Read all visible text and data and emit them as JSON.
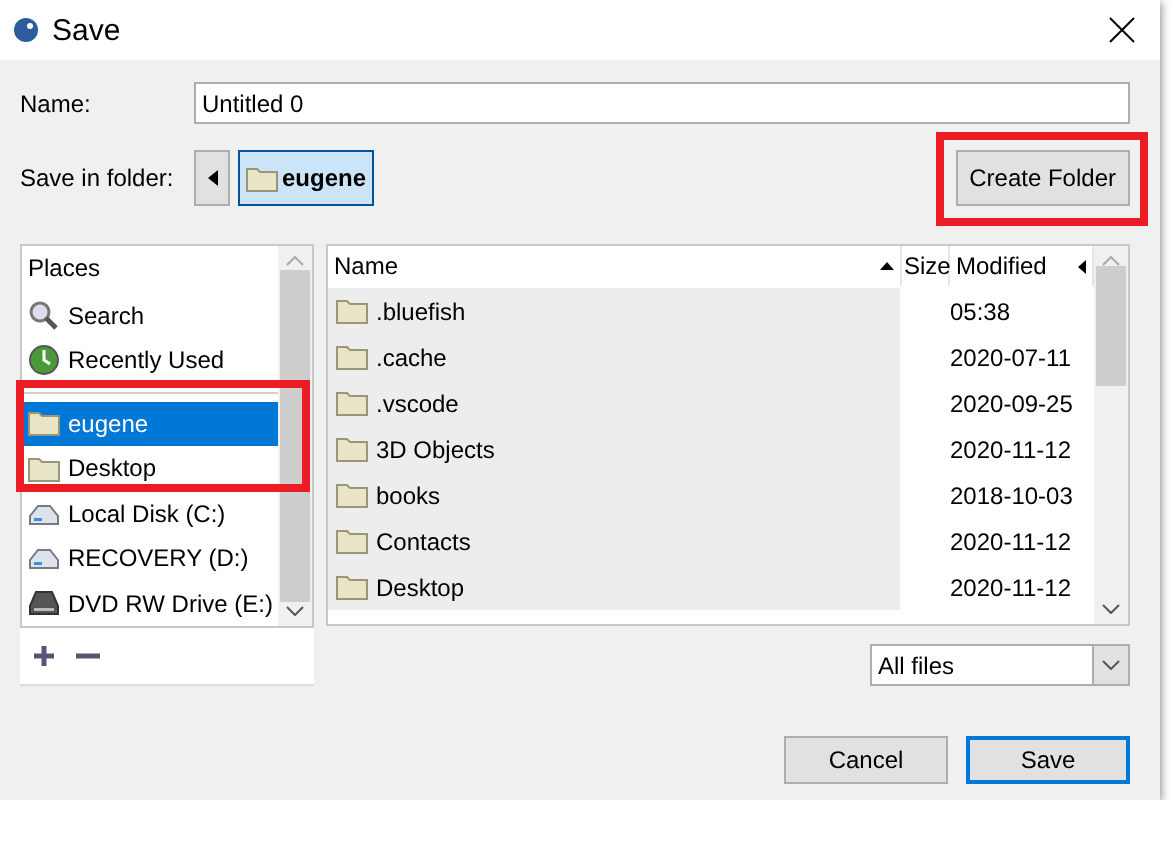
{
  "window": {
    "title": "Save"
  },
  "name_field": {
    "label": "Name:",
    "value": "Untitled 0"
  },
  "folder": {
    "label": "Save in folder:",
    "path": [
      {
        "label": "eugene",
        "selected": true
      }
    ]
  },
  "create_folder": {
    "label": "Create Folder",
    "highlighted": true
  },
  "places": {
    "heading": "Places",
    "items": [
      {
        "kind": "search",
        "label": "Search",
        "selected": false,
        "highlighted": false
      },
      {
        "kind": "recent",
        "label": "Recently Used",
        "selected": false,
        "highlighted": false
      },
      {
        "kind": "separator"
      },
      {
        "kind": "folder",
        "label": "eugene",
        "selected": true,
        "highlighted": true
      },
      {
        "kind": "folder",
        "label": "Desktop",
        "selected": false,
        "highlighted": true
      },
      {
        "kind": "disk",
        "label": "Local Disk (C:)",
        "selected": false,
        "highlighted": false
      },
      {
        "kind": "disk",
        "label": "RECOVERY (D:)",
        "selected": false,
        "highlighted": false
      },
      {
        "kind": "optical",
        "label": "DVD RW Drive (E:)",
        "selected": false,
        "highlighted": false
      }
    ]
  },
  "files": {
    "columns": [
      "Name",
      "Size",
      "Modified"
    ],
    "rows": [
      {
        "name": ".bluefish",
        "modified": "05:38"
      },
      {
        "name": ".cache",
        "modified": "2020-07-11"
      },
      {
        "name": ".vscode",
        "modified": "2020-09-25"
      },
      {
        "name": "3D Objects",
        "modified": "2020-11-12"
      },
      {
        "name": "books",
        "modified": "2018-10-03"
      },
      {
        "name": "Contacts",
        "modified": "2020-11-12"
      },
      {
        "name": "Desktop",
        "modified": "2020-11-12"
      }
    ]
  },
  "filter": {
    "value": "All files"
  },
  "buttons": [
    {
      "label": "Cancel",
      "default": false
    },
    {
      "label": "Save",
      "default": true
    }
  ]
}
